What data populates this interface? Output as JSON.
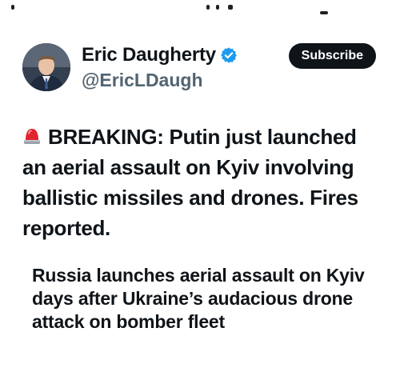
{
  "author": {
    "name": "Eric Daugherty",
    "handle": "@EricLDaugh",
    "avatar_icon": "profile-photo",
    "verified_icon": "verified-badge-icon"
  },
  "header": {
    "subscribe_label": "Subscribe"
  },
  "tweet": {
    "emoji_icon": "siren-icon",
    "text": "BREAKING: Putin just launched an aerial assault on Kyiv involving ballistic missiles and drones. Fires reported."
  },
  "link_card": {
    "headline": "Russia launches aerial assault on Kyiv days after Ukraine’s audacious drone attack on bomber fleet"
  },
  "colors": {
    "text": "#0f1419",
    "secondary_text": "#536471",
    "verified_blue": "#1d9bf0",
    "button_bg": "#0f1419",
    "siren_red": "#e0242d"
  }
}
